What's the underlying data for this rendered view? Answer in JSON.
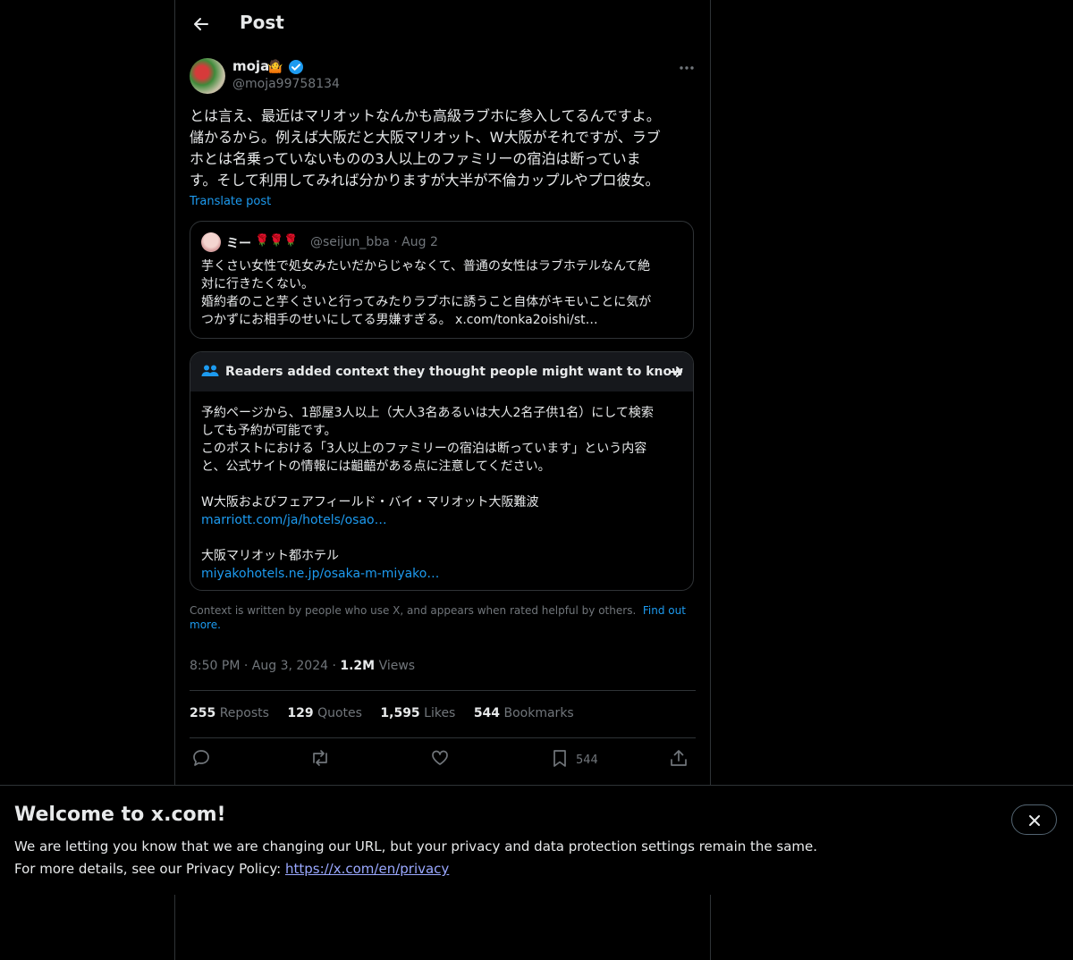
{
  "header": {
    "title": "Post"
  },
  "post": {
    "display_name": "moja",
    "emoji": "🤷",
    "handle": "@moja99758134",
    "lines": [
      "とは言え、最近はマリオットなんかも高級ラブホに参入してるんですよ。",
      "儲かるから。例えば大阪だと大阪マリオット、W大阪がそれですが、ラブ",
      "ホとは名乗っていないものの3人以上のファミリーの宿泊は断っていま",
      "す。そして利用してみれば分かりますが大半が不倫カップルやプロ彼女。"
    ],
    "translate_label": "Translate post"
  },
  "quote": {
    "name": "ミー",
    "roses": "🌹🌹🌹",
    "handle": "@seijun_bba",
    "date": "· Aug 2",
    "lines": [
      "芋くさい女性で処女みたいだからじゃなくて、普通の女性はラブホテルなんて絶",
      "対に行きたくない。",
      "婚約者のこと芋くさいと行ってみたりラブホに誘うこと自体がキモいことに気が",
      "つかずにお相手のせいにしてる男嫌すぎる。 x.com/tonka2oishi/st…"
    ]
  },
  "note": {
    "title": "Readers added context they thought people might want to know",
    "lines": [
      "予約ページから、1部屋3人以上（大人3名あるいは大人2名子供1名）にして検索",
      "しても予約が可能です。",
      "このポストにおける「3人以上のファミリーの宿泊は断っています」という内容",
      "と、公式サイトの情報には齟齬がある点に注意してください。"
    ],
    "hotel1": "W大阪およびフェアフィールド・バイ・マリオット大阪難波",
    "link1": "marriott.com/ja/hotels/osao…",
    "hotel2": "大阪マリオット都ホテル",
    "link2": "miyakohotels.ne.jp/osaka-m-miyako…"
  },
  "context": {
    "text": "Context is written by people who use X, and appears when rated helpful by others.",
    "link_part1": "Find out",
    "link_part2": "more."
  },
  "meta": {
    "time": "8:50 PM",
    "date": "Aug 3, 2024",
    "views_count": "1.2M",
    "views_label": "Views"
  },
  "stats": {
    "reposts_count": "255",
    "reposts_label": "Reposts",
    "quotes_count": "129",
    "quotes_label": "Quotes",
    "likes_count": "1,595",
    "likes_label": "Likes",
    "bookmarks_count": "544",
    "bookmarks_label": "Bookmarks"
  },
  "actions": {
    "bookmark_count": "544"
  },
  "banner": {
    "title": "Welcome to x.com!",
    "line1": "We are letting you know that we are changing our URL, but your privacy and data protection settings remain the same.",
    "line2": "For more details, see our Privacy Policy:",
    "link": "https://x.com/en/privacy"
  },
  "colors": {
    "accent": "#1d9bf0",
    "background": "#000000",
    "border": "#2f3336",
    "muted": "#71767b"
  },
  "icons": [
    "back-arrow-icon",
    "verified-badge-icon",
    "more-icon",
    "people-icon",
    "arrow-right-icon",
    "reply-icon",
    "repost-icon",
    "like-icon",
    "bookmark-icon",
    "share-icon",
    "close-icon"
  ]
}
